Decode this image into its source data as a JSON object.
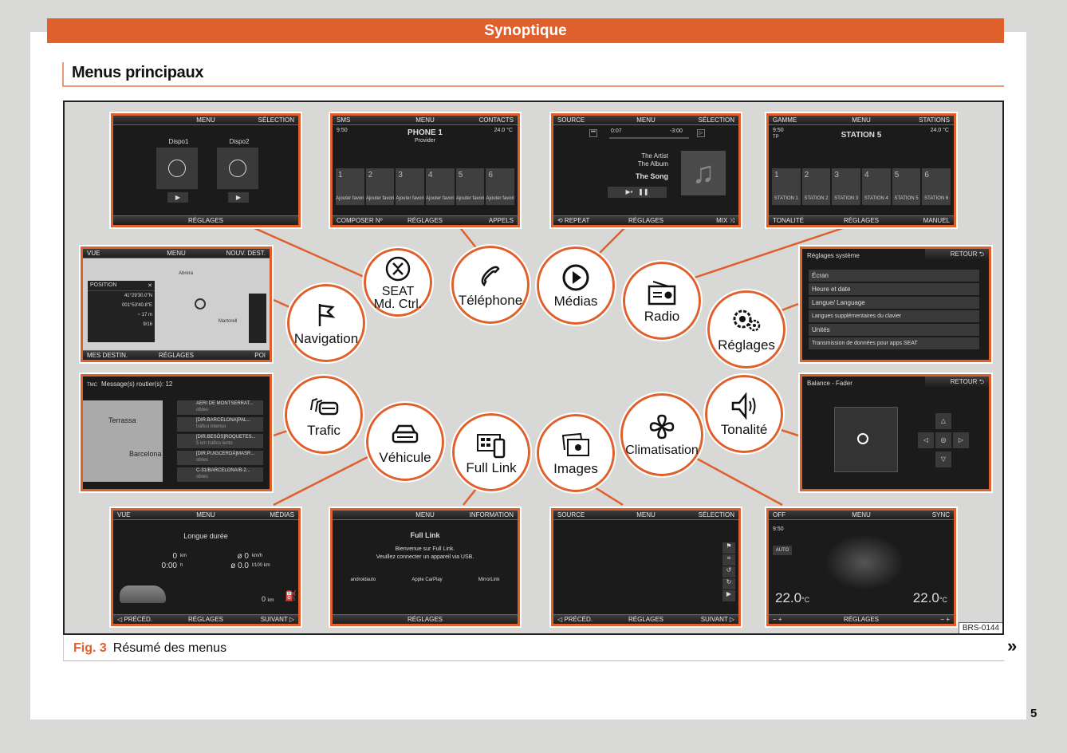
{
  "header": {
    "section": "Synoptique",
    "title": "Menus principaux"
  },
  "figure": {
    "code": "BRS-0144",
    "caption_label": "Fig. 3",
    "caption_text": "Résumé des menus",
    "more": "»"
  },
  "page_number": "5",
  "bubbles": {
    "seat_md_ctrl": {
      "line1": "SEAT",
      "line2": "Md. Ctrl."
    },
    "telephone": "Téléphone",
    "medias": "Médias",
    "radio": "Radio",
    "navigation": "Navigation",
    "reglages": "Réglages",
    "trafic": "Trafic",
    "vehicule": "Véhicule",
    "full_link": "Full Link",
    "images": "Images",
    "climatisation": "Climatisation",
    "tonalite": "Tonalité"
  },
  "screens": {
    "drive": {
      "top": [
        "",
        "MENU",
        "SÉLECTION"
      ],
      "bottom": [
        "",
        "RÉGLAGES",
        ""
      ],
      "dispo1": "Dispo1",
      "dispo2": "Dispo2"
    },
    "phone": {
      "top": [
        "SMS",
        "MENU",
        "CONTACTS"
      ],
      "bottom": [
        "COMPOSER Nº",
        "RÉGLAGES",
        "APPELS"
      ],
      "time": "9:50",
      "name": "PHONE 1",
      "provider": "Provider",
      "temp": "24.0 °C",
      "tiles": [
        {
          "n": "1",
          "t": "Ajouter favori"
        },
        {
          "n": "2",
          "t": "Ajouter favori"
        },
        {
          "n": "3",
          "t": "Ajouter favori"
        },
        {
          "n": "4",
          "t": "Ajouter favori"
        },
        {
          "n": "5",
          "t": "Ajouter favori"
        },
        {
          "n": "6",
          "t": "Ajouter favori"
        }
      ]
    },
    "media": {
      "top": [
        "SOURCE",
        "MENU",
        "SÉLECTION"
      ],
      "bottom": [
        "⟲ REPEAT",
        "RÉGLAGES",
        "MIX ⤨"
      ],
      "elapsed": "0:07",
      "remaining": "-3:00",
      "artist": "The Artist",
      "album": "The Album",
      "song": "The Song"
    },
    "radio": {
      "top": [
        "GAMME",
        "MENU",
        "STATIONS"
      ],
      "bottom": [
        "TONALITÉ",
        "RÉGLAGES",
        "MANUEL"
      ],
      "time": "9:50",
      "tp": "TP",
      "station": "STATION 5",
      "temp": "24.0 °C",
      "tiles": [
        {
          "n": "1",
          "t": "STATION 1"
        },
        {
          "n": "2",
          "t": "STATION 2"
        },
        {
          "n": "3",
          "t": "STATION 3"
        },
        {
          "n": "4",
          "t": "STATION 4"
        },
        {
          "n": "5",
          "t": "STATION 5"
        },
        {
          "n": "6",
          "t": "STATION 6"
        }
      ]
    },
    "nav": {
      "top": [
        "VUE",
        "MENU",
        "NOUV. DEST."
      ],
      "bottom": [
        "MES DESTIN.",
        "RÉGLAGES",
        "POI"
      ],
      "panel_title": "POSITION",
      "lat": "41°29'30.0\"N",
      "lon": "001°53'40.8\"E",
      "alt": "~ 17 m",
      "gps": "9/16",
      "places": [
        "Abrera",
        "Martorell"
      ]
    },
    "settings": {
      "title": "Réglages système",
      "back": "RETOUR ⮌",
      "items": [
        "Écran",
        "Heure et date",
        "Langue/ Language",
        "Langues supplémentaires du clavier",
        "Unités",
        "Transmission de données pour apps SEAT"
      ]
    },
    "traffic": {
      "title": "Message(s) routier(s): 12",
      "tmc": "TMC",
      "places": [
        "Terrassa",
        "Barcelona"
      ],
      "items": [
        {
          "a": "AERI DE MONTSERRAT...",
          "b": "obres"
        },
        {
          "a": "[DIR.BARCELONA]PAL...",
          "b": "tráfico intenso"
        },
        {
          "a": "[DIR.BESÒS]ROQUETES...",
          "b": "5 km tráfico lento"
        },
        {
          "a": "[DIR.PUIGCERDÀ]MASR...",
          "b": "obres"
        },
        {
          "a": "C-31/BARCELONA/B-2...",
          "b": "obres"
        }
      ]
    },
    "balance": {
      "title": "Balance - Fader",
      "back": "RETOUR ⮌"
    },
    "vehicle": {
      "top": [
        "VUE",
        "MENU",
        "MÉDIAS"
      ],
      "bottom": [
        "◁ PRÉCÉD.",
        "RÉGLAGES",
        "SUIVANT ▷"
      ],
      "title": "Longue durée",
      "distance": "0",
      "distance_unit": "km",
      "time": "0:00",
      "time_unit": "h",
      "speed": "ø 0",
      "speed_unit": "km/h",
      "consumption": "ø 0.0",
      "consumption_unit": "l/100 km",
      "range": "0",
      "range_unit": "km"
    },
    "fulllink": {
      "top": [
        "",
        "MENU",
        "INFORMATION"
      ],
      "bottom": [
        "",
        "RÉGLAGES",
        ""
      ],
      "title": "Full Link",
      "msg1": "Bienvenue sur Full Link.",
      "msg2": "Veuillez connecter un appareil via USB.",
      "logos": [
        "androidauto",
        "Apple CarPlay",
        "MirrorLink"
      ]
    },
    "images": {
      "top": [
        "SOURCE",
        "MENU",
        "SÉLECTION"
      ],
      "bottom": [
        "◁ PRÉCÉD.",
        "RÉGLAGES",
        "SUIVANT ▷"
      ]
    },
    "clim": {
      "top": [
        "OFF",
        "MENU",
        "SYNC"
      ],
      "bottom": [
        "−    +",
        "RÉGLAGES",
        "−    +"
      ],
      "time": "9:50",
      "auto": "AUTO",
      "temp_left": "22.0",
      "temp_right": "22.0",
      "unit": "°C"
    }
  }
}
